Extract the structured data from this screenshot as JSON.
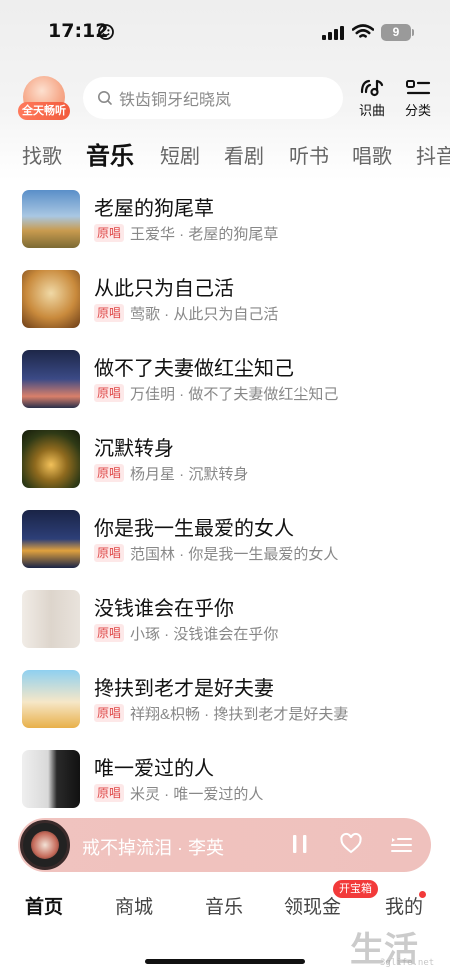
{
  "status_bar": {
    "time": "17:12",
    "battery": "9"
  },
  "header": {
    "badge_label": "全天畅听",
    "search_placeholder": "铁齿铜牙纪晓岚",
    "recognize_label": "识曲",
    "category_label": "分类"
  },
  "tabs": [
    {
      "label": "找歌"
    },
    {
      "label": "音乐"
    },
    {
      "label": "短剧"
    },
    {
      "label": "看剧"
    },
    {
      "label": "听书"
    },
    {
      "label": "唱歌"
    },
    {
      "label": "抖音"
    }
  ],
  "songs": [
    {
      "title": "老屋的狗尾草",
      "tag": "原唱",
      "subtitle": "王爱华 · 老屋的狗尾草"
    },
    {
      "title": "从此只为自己活",
      "tag": "原唱",
      "subtitle": "莺歌 · 从此只为自己活"
    },
    {
      "title": "做不了夫妻做红尘知己",
      "tag": "原唱",
      "subtitle": "万佳明 · 做不了夫妻做红尘知己"
    },
    {
      "title": "沉默转身",
      "tag": "原唱",
      "subtitle": "杨月星 · 沉默转身"
    },
    {
      "title": "你是我一生最爱的女人",
      "tag": "原唱",
      "subtitle": "范国林 · 你是我一生最爱的女人"
    },
    {
      "title": "没钱谁会在乎你",
      "tag": "原唱",
      "subtitle": "小琢 · 没钱谁会在乎你"
    },
    {
      "title": "搀扶到老才是好夫妻",
      "tag": "原唱",
      "subtitle": "祥翔&枳畅 · 搀扶到老才是好夫妻"
    },
    {
      "title": "唯一爱过的人",
      "tag": "原唱",
      "subtitle": "米灵 · 唯一爱过的人"
    }
  ],
  "player": {
    "now_playing": "戒不掉流泪 · 李英"
  },
  "bottom_nav": {
    "items": [
      {
        "label": "首页"
      },
      {
        "label": "商城"
      },
      {
        "label": "音乐"
      },
      {
        "label": "领现金"
      },
      {
        "label": "我的"
      }
    ],
    "treasure_badge": "开宝箱"
  },
  "watermark": {
    "text": "生活",
    "sub": "3glife.net"
  },
  "colors": {
    "accent_red": "#f23a3a",
    "orig_tag_bg": "#fde8e8",
    "player_bg": "#f0c3bf"
  }
}
